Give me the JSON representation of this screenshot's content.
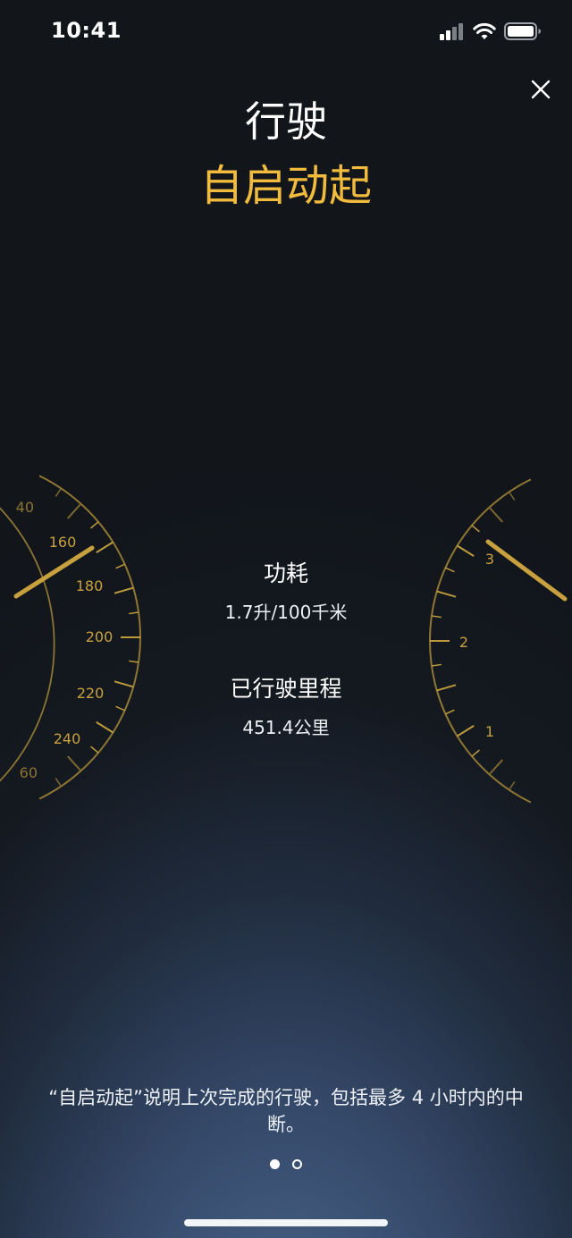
{
  "status_bar": {
    "time": "10:41",
    "signal_icon": "cellular-signal-icon",
    "wifi_icon": "wifi-icon",
    "battery_icon": "battery-icon"
  },
  "header": {
    "title": "行驶",
    "subtitle": "自启动起",
    "close_icon": "close-icon"
  },
  "colors": {
    "accent": "#f1bb3d",
    "gauge": "#b79a3c"
  },
  "speedometer": {
    "labels": [
      "40",
      "160",
      "180",
      "200",
      "220",
      "240",
      "60"
    ]
  },
  "fuel_gauge": {
    "labels": [
      "3",
      "2",
      "1"
    ]
  },
  "stats": {
    "consumption_label": "功耗",
    "consumption_value": "1.7升/100千米",
    "distance_label": "已行驶里程",
    "distance_value": "451.4公里"
  },
  "footer": {
    "note": "“自启动起”说明上次完成的行驶，包括最多 4 小时内的中断。",
    "page_indicator": {
      "current": 1,
      "total": 2
    }
  }
}
